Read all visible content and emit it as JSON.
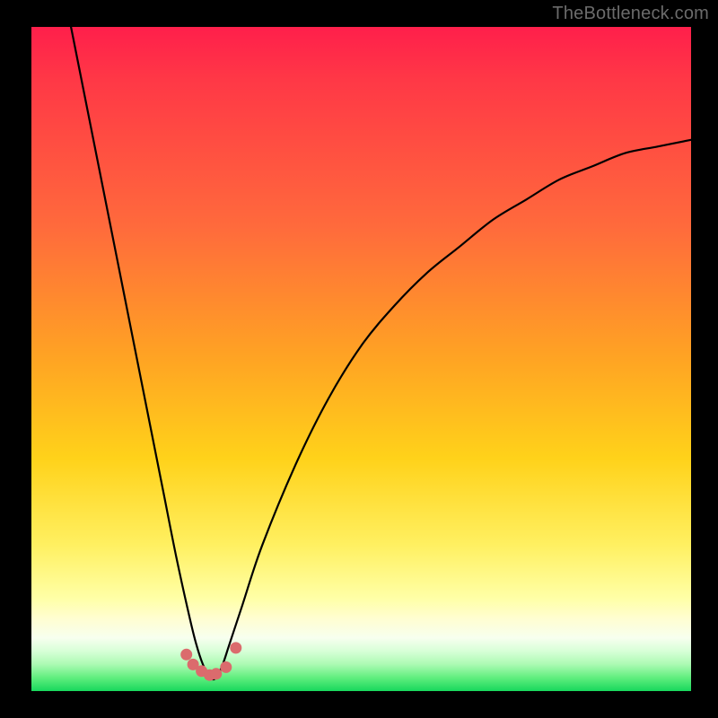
{
  "attribution": "TheBottleneck.com",
  "colors": {
    "background": "#000000",
    "curve": "#000000",
    "markers": "#db6b6d",
    "gradient_stops": [
      "#ff1f4b",
      "#ff6a3c",
      "#ffd21a",
      "#ffffa6",
      "#18d85c"
    ]
  },
  "chart_data": {
    "type": "line",
    "title": "",
    "xlabel": "",
    "ylabel": "",
    "xlim": [
      0,
      100
    ],
    "ylim": [
      0,
      100
    ],
    "note": "No numeric axes/ticks are shown; x and y are normalized 0–100 estimates from pixel position. y=0 is the bottom (green), y=100 is the top (red). The curve is a V-shaped bottleneck profile with its minimum near x≈27.",
    "series": [
      {
        "name": "bottleneck-curve",
        "x": [
          6,
          10,
          14,
          18,
          20,
          22,
          24,
          25,
          26,
          27,
          28,
          29,
          30,
          32,
          35,
          40,
          45,
          50,
          55,
          60,
          65,
          70,
          75,
          80,
          85,
          90,
          95,
          100
        ],
        "y": [
          100,
          80,
          60,
          40,
          30,
          20,
          11,
          7,
          4,
          2,
          2,
          4,
          7,
          13,
          22,
          34,
          44,
          52,
          58,
          63,
          67,
          71,
          74,
          77,
          79,
          81,
          82,
          83
        ]
      }
    ],
    "markers": {
      "name": "highlight-points",
      "note": "Small salmon-colored dots clustered near the curve minimum.",
      "x": [
        23.5,
        24.5,
        25.8,
        27.0,
        28.0,
        29.5,
        31.0
      ],
      "y": [
        5.5,
        4.0,
        3.0,
        2.4,
        2.6,
        3.6,
        6.5
      ]
    }
  }
}
